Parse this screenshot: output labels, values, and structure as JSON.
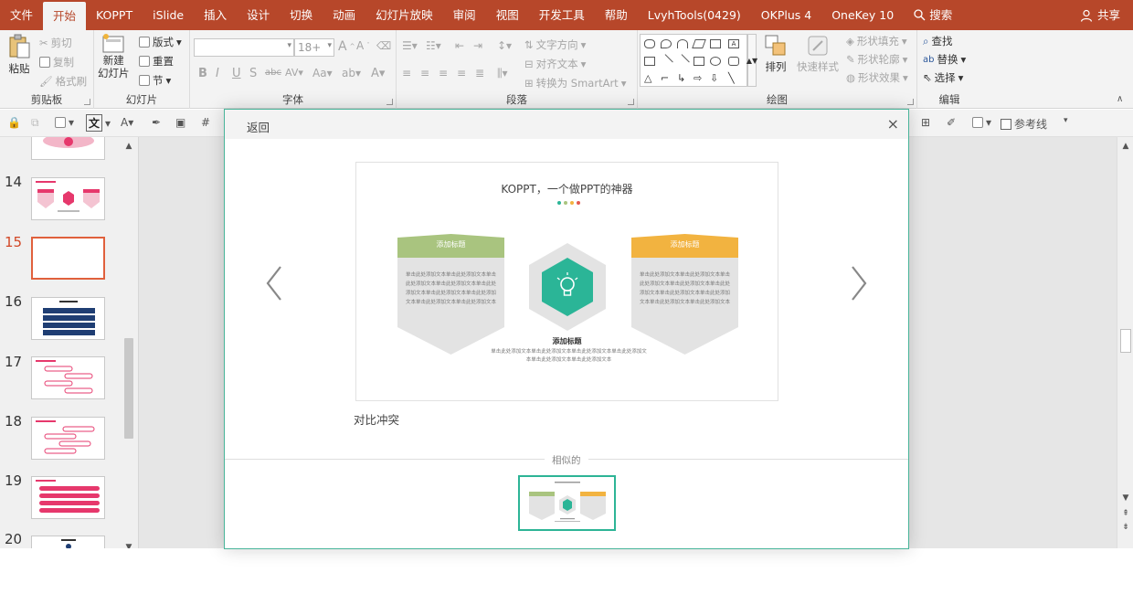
{
  "menubar": {
    "tabs": [
      "文件",
      "开始",
      "KOPPT",
      "iSlide",
      "插入",
      "设计",
      "切换",
      "动画",
      "幻灯片放映",
      "审阅",
      "视图",
      "开发工具",
      "帮助",
      "LvyhTools(0429)",
      "OKPlus 4",
      "OneKey 10"
    ],
    "active_tab": "开始",
    "search_label": "搜索",
    "share_label": "共享",
    "bar_color": "#b7472a"
  },
  "ribbon": {
    "clipboard": {
      "label": "剪贴板",
      "paste": "粘贴",
      "cut": "剪切",
      "copy": "复制",
      "format_painter": "格式刷"
    },
    "slides": {
      "label": "幻灯片",
      "new_slide_1": "新建",
      "new_slide_2": "幻灯片",
      "layout": "版式",
      "reset": "重置",
      "section": "节"
    },
    "font": {
      "label": "字体",
      "font_name": "",
      "font_size": "18+"
    },
    "paragraph": {
      "label": "段落",
      "text_direction": "文字方向",
      "align_text": "对齐文本",
      "convert_smartart": "转换为 SmartArt"
    },
    "drawing": {
      "label": "绘图",
      "arrange": "排列",
      "quick_styles": "快速样式",
      "shape_fill": "形状填充",
      "shape_outline": "形状轮廓",
      "shape_effects": "形状效果"
    },
    "editing": {
      "label": "编辑",
      "find": "查找",
      "replace": "替换",
      "select": "选择"
    }
  },
  "toolbar2": {
    "guides_label": "参考线",
    "text_icon": "文"
  },
  "slides": [
    {
      "num": "14"
    },
    {
      "num": "15"
    },
    {
      "num": "16"
    },
    {
      "num": "17"
    },
    {
      "num": "18"
    },
    {
      "num": "19"
    },
    {
      "num": "20"
    }
  ],
  "current_slide": "15",
  "dialog": {
    "back_label": "返回",
    "close_icon": "×",
    "caption": "对比冲突",
    "similar_label": "相似的",
    "preview": {
      "title": "KOPPT，一个做PPT的神器",
      "left_card": {
        "title": "添加标题",
        "body": "单击此处添加文本单击此处添加文本单击此处添加文本单击此处添加文本单击此处添加文本单击此处添加文本单击此处添加文本单击此处添加文本单击此处添加文本",
        "color": "#a9c47f"
      },
      "right_card": {
        "title": "添加标题",
        "body": "单击此处添加文本单击此处添加文本单击此处添加文本单击此处添加文本单击此处添加文本单击此处添加文本单击此处添加文本单击此处添加文本单击此处添加文本",
        "color": "#f2b340"
      },
      "center": {
        "title": "添加标题",
        "body": "单击此处添加文本单击此处添加文本单击此处添加文本单击此处添加文本单击此处添加文本单击此处添加文本",
        "color": "#2bb597"
      },
      "dot_colors": [
        "#2bb597",
        "#a9c47f",
        "#f2b340",
        "#e45a4f"
      ]
    }
  }
}
